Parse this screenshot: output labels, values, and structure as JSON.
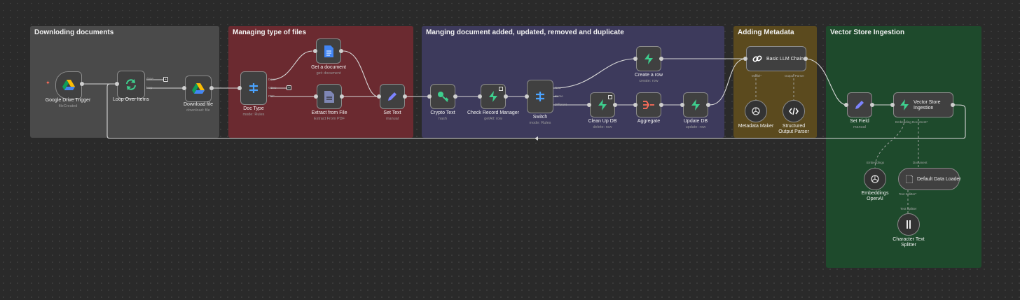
{
  "groups": {
    "download": "Downloding documents",
    "types": "Managing type of files",
    "manage": "Manging document added, updated, removed and duplicate",
    "metadata": "Adding Metadata",
    "vector": "Vector Store Ingestion"
  },
  "colors": {
    "canvas": "#2a2a2a",
    "group_download": "#4a4a4a",
    "group_types": "#6b2a30",
    "group_manage": "#3d3a5c",
    "group_metadata": "#5b4a1e",
    "group_vector": "#1e4a2c",
    "supabase": "#3ecf8e",
    "edit": "#7c83fd"
  },
  "nodes": {
    "gdrive_trigger": {
      "label": "Google Drive Trigger",
      "sub": "fileCreated",
      "icon": "google-drive-icon"
    },
    "loop": {
      "label": "Loop Over Items",
      "sub": "",
      "icon": "refresh-icon",
      "out1": "done",
      "out2": "loop"
    },
    "download_file": {
      "label": "Download file",
      "sub": "download: file",
      "icon": "google-drive-icon"
    },
    "doc_type": {
      "label": "Doc Type",
      "sub": "mode: Rules",
      "icon": "switch-icon",
      "out1": "Docs",
      "out2": "GDoc",
      "out3": "PDF"
    },
    "get_document": {
      "label": "Get a document",
      "sub": "get: document",
      "icon": "google-docs-icon"
    },
    "extract_file": {
      "label": "Extract from File",
      "sub": "Extract From PDF",
      "icon": "file-extract-icon"
    },
    "set_text": {
      "label": "Set Text",
      "sub": "manual",
      "icon": "pencil-icon"
    },
    "crypto": {
      "label": "Crypto Text",
      "sub": "hash",
      "icon": "key-icon"
    },
    "check_record": {
      "label": "Check Record Manager",
      "sub": "getAll: row",
      "icon": "supabase-icon"
    },
    "switch": {
      "label": "Switch",
      "sub": "mode: Rules",
      "icon": "switch-icon",
      "out1": "New",
      "out2": "Same",
      "out3": "Different"
    },
    "create_row": {
      "label": "Create a row",
      "sub": "create: row",
      "icon": "supabase-icon"
    },
    "cleanup": {
      "label": "Clean Up DB",
      "sub": "delete: row",
      "icon": "supabase-icon"
    },
    "aggregate": {
      "label": "Aggregate",
      "sub": "",
      "icon": "aggregate-icon"
    },
    "update_db": {
      "label": "Update DB",
      "sub": "update: row",
      "icon": "supabase-icon"
    },
    "llm_chain": {
      "label": "Basic LLM Chain",
      "icon": "link-icon",
      "port_model": "Model*",
      "port_parser": "Output Parser"
    },
    "metadata_maker": {
      "label": "Metadata Maker",
      "icon": "openai-icon"
    },
    "structured_parser": {
      "label": "Structured Output Parser",
      "icon": "code-icon"
    },
    "set_field": {
      "label": "Set Field",
      "sub": "manual",
      "icon": "pencil-icon"
    },
    "vector_store": {
      "label": "Vector Store Ingestion",
      "icon": "supabase-icon",
      "port_embed": "Embedding",
      "port_doc": "Document*"
    },
    "embeddings": {
      "label": "Embeddings OpenAI",
      "icon": "openai-icon",
      "port": "Embeddings"
    },
    "data_loader": {
      "label": "Default Data Loader",
      "icon": "document-icon",
      "port_doc": "Document",
      "port_split": "Text Splitter*"
    },
    "splitter": {
      "label": "Character Text Splitter",
      "icon": "splitter-icon",
      "port": "Text Splitter"
    }
  }
}
